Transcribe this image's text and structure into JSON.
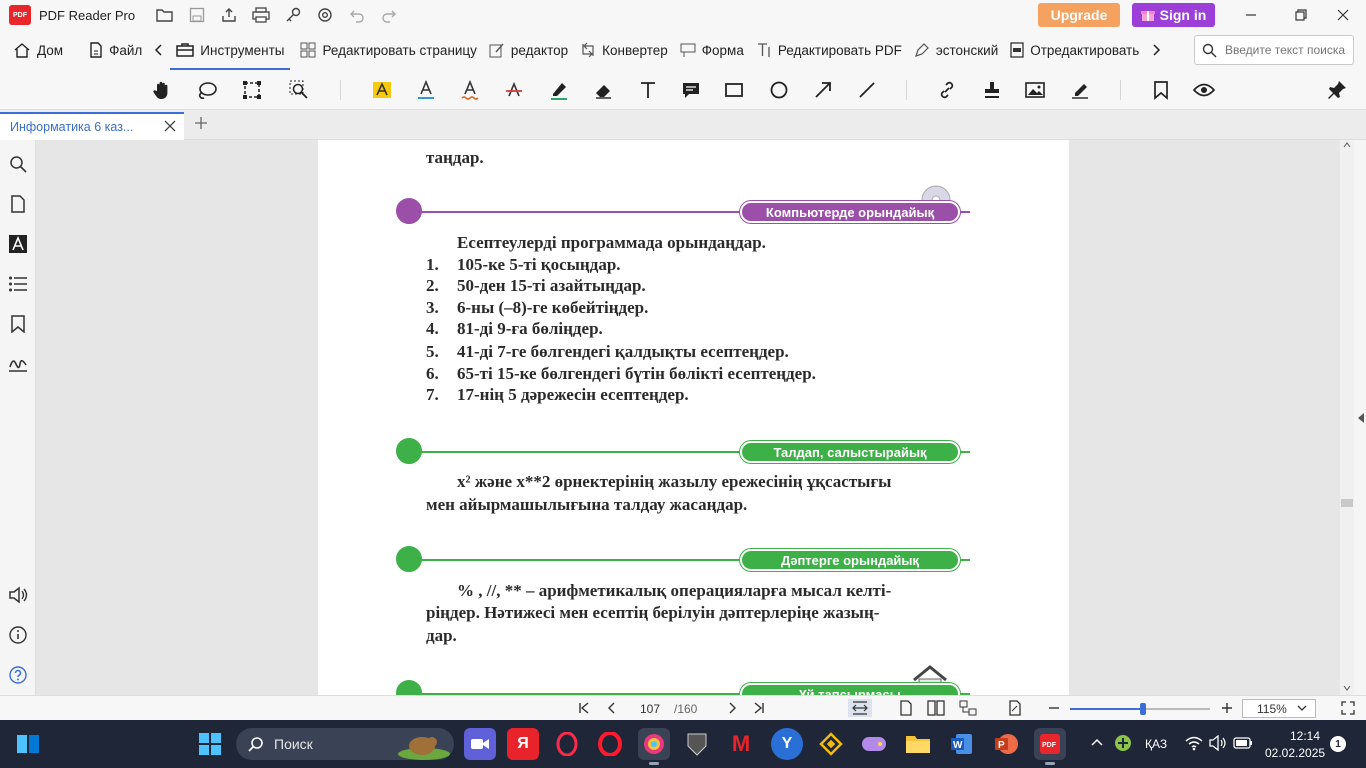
{
  "titlebar": {
    "app_name": "PDF Reader Pro",
    "logo_text": "PDF",
    "upgrade_label": "Upgrade",
    "signin_label": "Sign in",
    "upgrade_color": "#f5a15f",
    "signin_color": "#9b3fd8"
  },
  "menubar": {
    "items": [
      {
        "label": "Дом",
        "icon": "home-icon"
      },
      {
        "label": "Файл",
        "icon": "file-icon"
      },
      {
        "label": "Инструменты",
        "icon": "toolbox-icon"
      },
      {
        "label": "Редактировать страницу",
        "icon": "grid-icon"
      },
      {
        "label": "редактор",
        "icon": "edit-icon"
      },
      {
        "label": "Конвертер",
        "icon": "convert-icon"
      },
      {
        "label": "Форма",
        "icon": "form-icon"
      },
      {
        "label": "Редактировать PDF",
        "icon": "text-cursor-icon"
      },
      {
        "label": "эстонский",
        "icon": "pen-nib-icon"
      },
      {
        "label": "Отредактировать",
        "icon": "redact-icon"
      }
    ],
    "search_placeholder": "Введите текст поиска"
  },
  "tabs": {
    "document_tab": "Информатика 6 каз..."
  },
  "document": {
    "top_partial": "таңдар.",
    "section1_title": "Компьютерде орындайық",
    "section1_intro": "Есептеулерді программада орындаңдар.",
    "section1_items": [
      {
        "num": "1.",
        "text": "105-ке 5-ті қосыңдар."
      },
      {
        "num": "2.",
        "text": "50-ден 15-ті азайтыңдар."
      },
      {
        "num": "3.",
        "text": "6-ны (–8)-ге көбейтіңдер."
      },
      {
        "num": "4.",
        "text": "81-ді 9-ға бөліңдер."
      },
      {
        "num": "5.",
        "text": "41-ді 7-ге бөлгендегі қалдықты есептеңдер."
      },
      {
        "num": "6.",
        "text": "65-ті 15-ке бөлгендегі бүтін бөлікті есептеңдер."
      },
      {
        "num": "7.",
        "text": "17-нің 5 дәрежесін есептеңдер."
      }
    ],
    "section2_title": "Талдап, салыстырайық",
    "section2_line1_a": "x² және ",
    "section2_line1_b": "x**2",
    "section2_line1_c": " өрнектерінің жазылу ережесінің ұқсастығы",
    "section2_line2": "мен айырмашылығына талдау жасаңдар.",
    "section3_title": "Дәптерге орындайық",
    "section3_line1": "% , //, ** – арифметикалық операцияларға мысал келті-",
    "section3_line2": "ріңдер. Нәтижесі мен есептің берілуін дәптерлеріңе жазың-",
    "section3_line3": "дар.",
    "section4_title": "Үй тапсырмасы",
    "purple": "#9b4fa8",
    "green": "#3db048"
  },
  "statusbar": {
    "current_page": "107",
    "total_pages": "/160",
    "zoom": "115%",
    "zoom_fraction": 0.52
  },
  "taskbar": {
    "search_label": "Поиск",
    "language": "ҚАЗ",
    "time": "12:14",
    "date": "02.02.2025",
    "notification_count": "1"
  }
}
